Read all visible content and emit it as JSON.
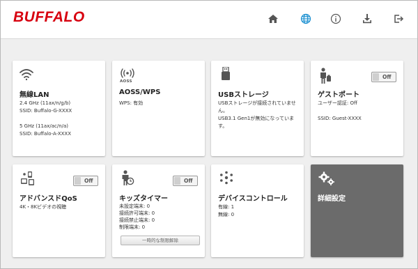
{
  "brand": {
    "logo_text": "BUFFALO",
    "color": "#d7000f"
  },
  "nav": [
    {
      "icon": "home-icon"
    },
    {
      "icon": "globe-icon",
      "active": true
    },
    {
      "icon": "info-icon"
    },
    {
      "icon": "download-icon"
    },
    {
      "icon": "logout-icon"
    }
  ],
  "colors": {
    "accent": "#1a8fd0",
    "dark_card": "#6b6b6b"
  },
  "cards": {
    "wireless": {
      "title": "無線LAN",
      "line1": "2.4 GHz (11ax/n/g/b)",
      "line2": "SSID: Buffalo-G-XXXX",
      "line3": "5 GHz (11ax/ac/n/a)",
      "line4": "SSID: Buffalo-A-XXXX"
    },
    "aoss": {
      "title": "AOSS/WPS",
      "icon_label": "AOSS",
      "line1": "WPS: 有効"
    },
    "usb": {
      "title": "USBストレージ",
      "line1": "USBストレージが接続されていません。",
      "line2": "USB3.1 Gen1が無効になっています。"
    },
    "guest": {
      "title": "ゲストポート",
      "toggle": "Off",
      "line1": "ユーザー認証: Off",
      "line2": "SSID: Guest-XXXX"
    },
    "qos": {
      "title": "アドバンスドQoS",
      "toggle": "Off",
      "line1": "4K・8Kビデオの視聴"
    },
    "kids": {
      "title": "キッズタイマー",
      "toggle": "Off",
      "line1": "未設定端末: 0",
      "line2": "接続許可端末: 0",
      "line3": "接続禁止端末: 0",
      "line4": "制限端末: 0",
      "button": "一時的な制限解除"
    },
    "device": {
      "title": "デバイスコントロール",
      "line1": "有線: 1",
      "line2": "無線: 0"
    },
    "advanced": {
      "title": "詳細設定"
    }
  }
}
